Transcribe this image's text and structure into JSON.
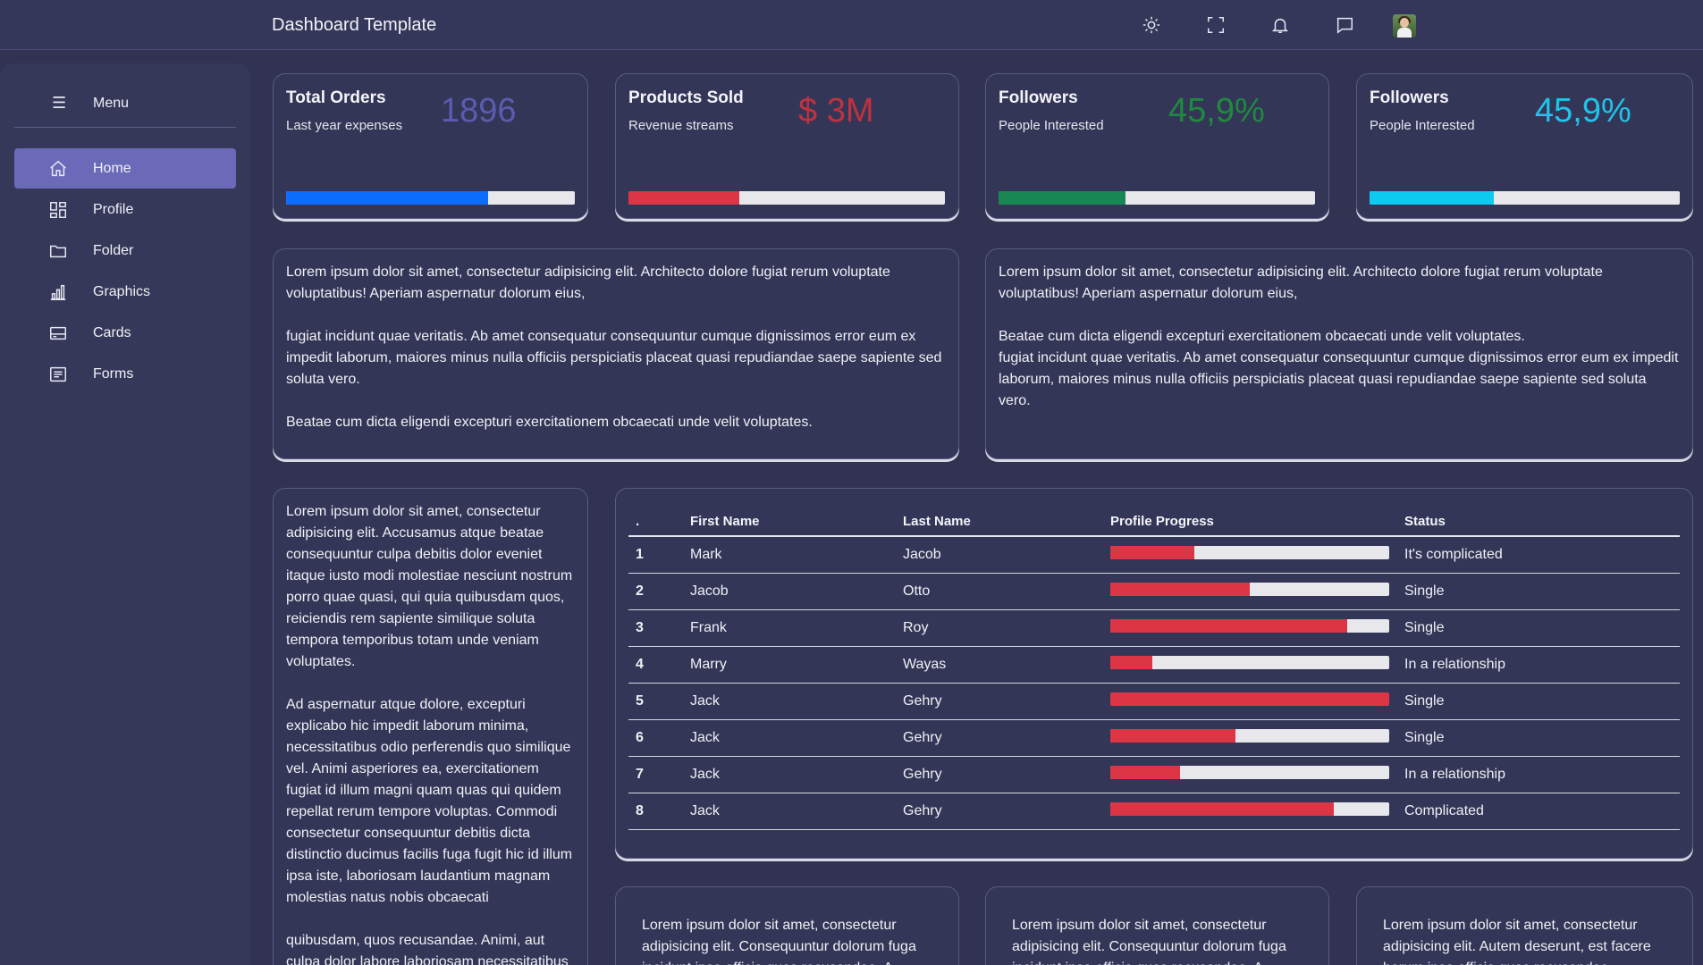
{
  "header": {
    "title": "Dashboard Template",
    "icons": [
      "sun-icon",
      "fullscreen-icon",
      "bell-icon",
      "chat-icon"
    ]
  },
  "sidebar": {
    "menu_label": "Menu",
    "items": [
      {
        "label": "Home",
        "icon": "home-icon",
        "active": true
      },
      {
        "label": "Profile",
        "icon": "dashboard-grid-icon",
        "active": false
      },
      {
        "label": "Folder",
        "icon": "folder-icon",
        "active": false
      },
      {
        "label": "Graphics",
        "icon": "bar-chart-icon",
        "active": false
      },
      {
        "label": "Cards",
        "icon": "card-icon",
        "active": false
      },
      {
        "label": "Forms",
        "icon": "form-icon",
        "active": false
      }
    ]
  },
  "stats": [
    {
      "title": "Total Orders",
      "subtitle": "Last year expenses",
      "value": "1896",
      "color": "#5a5cb0",
      "bar_color": "#0d6efd",
      "progress": 0.7
    },
    {
      "title": "Products Sold",
      "subtitle": "Revenue streams",
      "value": "$ 3M",
      "color": "#c0323f",
      "bar_color": "#dc3545",
      "progress": 0.35
    },
    {
      "title": "Followers",
      "subtitle": "People Interested",
      "value": "45,9%",
      "color": "#1e8a3e",
      "bar_color": "#198754",
      "progress": 0.4
    },
    {
      "title": "Followers",
      "subtitle": "People Interested",
      "value": "45,9%",
      "color": "#1fc4ec",
      "bar_color": "#0dcaf0",
      "progress": 0.4
    }
  ],
  "text_left": [
    "Lorem ipsum dolor sit amet, consectetur adipisicing elit. Architecto dolore fugiat rerum voluptate voluptatibus! Aperiam aspernatur dolorum eius,",
    "fugiat incidunt quae veritatis. Ab amet consequatur consequuntur cumque dignissimos error eum ex impedit laborum, maiores minus nulla officiis perspiciatis placeat quasi repudiandae saepe sapiente sed soluta vero.",
    "Beatae cum dicta eligendi excepturi exercitationem obcaecati unde velit voluptates."
  ],
  "text_right_p1": "Lorem ipsum dolor sit amet, consectetur adipisicing elit. Architecto dolore fugiat rerum voluptate voluptatibus! Aperiam aspernatur dolorum eius,",
  "text_right_p2a": "Beatae cum dicta eligendi excepturi exercitationem obcaecati unde velit voluptates.",
  "text_right_p2b": "fugiat incidunt quae veritatis. Ab amet consequatur consequuntur cumque dignissimos error eum ex impedit laborum, maiores minus nulla officiis perspiciatis placeat quasi repudiandae saepe sapiente sed soluta vero.",
  "text_column": [
    "Lorem ipsum dolor sit amet, consectetur adipisicing elit. Accusamus atque beatae consequuntur culpa debitis dolor eveniet itaque iusto modi molestiae nesciunt nostrum porro quae quasi, qui quia quibusdam quos, reiciendis rem sapiente similique soluta tempora temporibus totam unde veniam voluptates.",
    "Ad aspernatur atque dolore, excepturi explicabo hic impedit laborum minima, necessitatibus odio perferendis quo similique vel. Animi asperiores ea, exercitationem fugiat id illum magni quam quas qui quidem repellat rerum tempore voluptas. Commodi consectetur consequuntur debitis dicta distinctio ducimus facilis fuga fugit hic id illum ipsa iste, laboriosam laudantium magnam molestias natus nobis obcaecati",
    "quibusdam, quos recusandae. Animi, aut culpa dolor labore laboriosam necessitatibus"
  ],
  "table": {
    "headers": [
      ".",
      "First Name",
      "Last Name",
      "Profile Progress",
      "Status"
    ],
    "rows": [
      {
        "num": "1",
        "first": "Mark",
        "last": "Jacob",
        "progress": 0.3,
        "status": "It's complicated"
      },
      {
        "num": "2",
        "first": "Jacob",
        "last": "Otto",
        "progress": 0.5,
        "status": "Single"
      },
      {
        "num": "3",
        "first": "Frank",
        "last": "Roy",
        "progress": 0.85,
        "status": "Single"
      },
      {
        "num": "4",
        "first": "Marry",
        "last": "Wayas",
        "progress": 0.15,
        "status": "In a relationship"
      },
      {
        "num": "5",
        "first": "Jack",
        "last": "Gehry",
        "progress": 1.0,
        "status": "Single"
      },
      {
        "num": "6",
        "first": "Jack",
        "last": "Gehry",
        "progress": 0.45,
        "status": "Single"
      },
      {
        "num": "7",
        "first": "Jack",
        "last": "Gehry",
        "progress": 0.25,
        "status": "In a relationship"
      },
      {
        "num": "8",
        "first": "Jack",
        "last": "Gehry",
        "progress": 0.8,
        "status": "Complicated"
      }
    ]
  },
  "bottom_cards": [
    "Lorem ipsum dolor sit amet, consectetur adipisicing elit. Consequuntur dolorum fuga incidunt ipsa officia quas recusandae. A",
    "Lorem ipsum dolor sit amet, consectetur adipisicing elit. Consequuntur dolorum fuga incidunt ipsa officia quas recusandae. A",
    "Lorem ipsum dolor sit amet, consectetur adipisicing elit. Autem deserunt, est facere harum ipsa officia quas recusandae"
  ]
}
